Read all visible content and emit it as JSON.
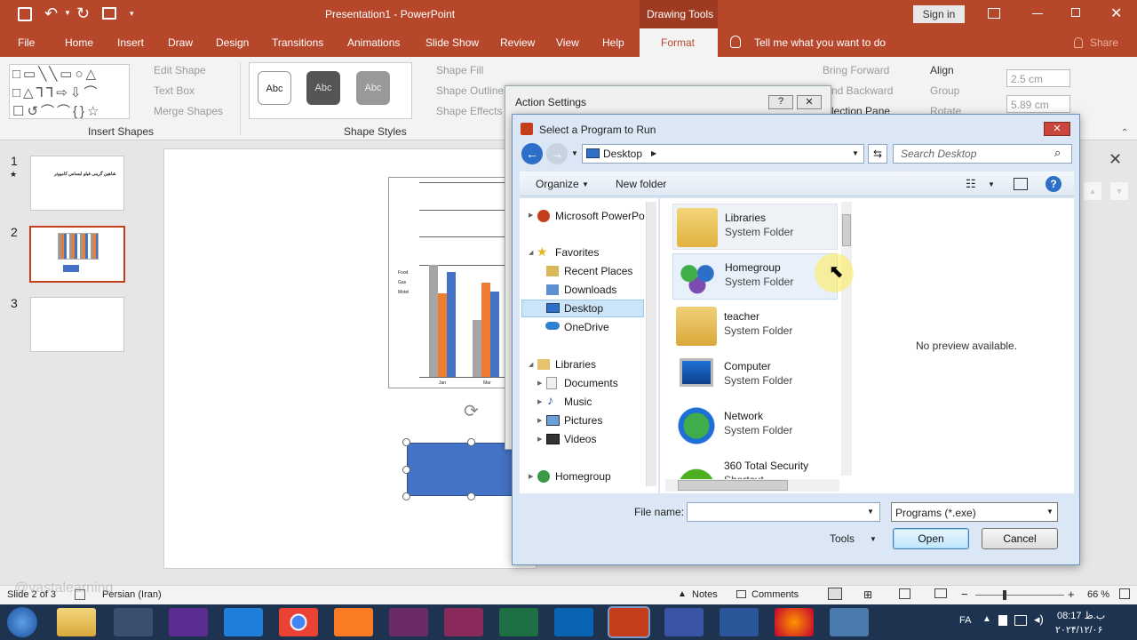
{
  "app": {
    "title": "Presentation1 - PowerPoint",
    "context_tab": "Drawing Tools",
    "sign_in": "Sign in"
  },
  "tabs": [
    "File",
    "Home",
    "Insert",
    "Draw",
    "Design",
    "Transitions",
    "Animations",
    "Slide Show",
    "Review",
    "View",
    "Help",
    "Format"
  ],
  "tell_me": "Tell me what you want to do",
  "share": "Share",
  "ribbon": {
    "edit_shape": "Edit Shape",
    "text_box": "Text Box",
    "merge_shapes": "Merge Shapes",
    "insert_shapes_group": "Insert Shapes",
    "style_abc": "Abc",
    "shape_fill": "Shape Fill",
    "shape_outline": "Shape Outline",
    "shape_effects": "Shape Effects",
    "shape_styles_group": "Shape Styles",
    "bring_forward": "Bring Forward",
    "send_backward": "nd Backward",
    "selection_pane": "lection Pane",
    "align": "Align",
    "group": "Group",
    "rotate": "Rotate",
    "height": "2.5 cm",
    "width": "5.89 cm"
  },
  "slides": {
    "numbers": [
      "1",
      "2",
      "3"
    ],
    "slide1_text": "شاهین گرینی فیلو لبساس کامپوتر"
  },
  "chart": {
    "legend": [
      "Food",
      "Gas",
      "Motel"
    ],
    "categories": [
      "Jan",
      "Mar"
    ]
  },
  "action_settings": {
    "title": "Action Settings",
    "help": "?",
    "close": "✕"
  },
  "file_dialog": {
    "title": "Select a Program to Run",
    "path": "Desktop",
    "search_placeholder": "Search Desktop",
    "organize": "Organize",
    "new_folder": "New folder",
    "nav": {
      "top": "Microsoft PowerPo",
      "favorites": "Favorites",
      "fav_items": [
        "Recent Places",
        "Downloads",
        "Desktop",
        "OneDrive"
      ],
      "libraries": "Libraries",
      "lib_items": [
        "Documents",
        "Music",
        "Pictures",
        "Videos"
      ],
      "homegroup": "Homegroup"
    },
    "files": [
      {
        "name": "Libraries",
        "type": "System Folder"
      },
      {
        "name": "Homegroup",
        "type": "System Folder"
      },
      {
        "name": "teacher",
        "type": "System Folder"
      },
      {
        "name": "Computer",
        "type": "System Folder"
      },
      {
        "name": "Network",
        "type": "System Folder"
      },
      {
        "name": "360 Total Security",
        "type": "Shortcut"
      }
    ],
    "preview": "No preview available.",
    "file_name_label": "File name:",
    "file_name_value": "",
    "filter": "Programs (*.exe)",
    "tools": "Tools",
    "open": "Open",
    "cancel": "Cancel"
  },
  "status": {
    "slide": "Slide 2 of 3",
    "language": "Persian (Iran)",
    "notes": "Notes",
    "comments": "Comments",
    "zoom": "66 %",
    "watermark": "@vastalearning"
  },
  "taskbar": {
    "lang": "FA",
    "time": "08:17 ب.ظ",
    "date": "۲۰۲۴/۱۲/۰۶"
  }
}
